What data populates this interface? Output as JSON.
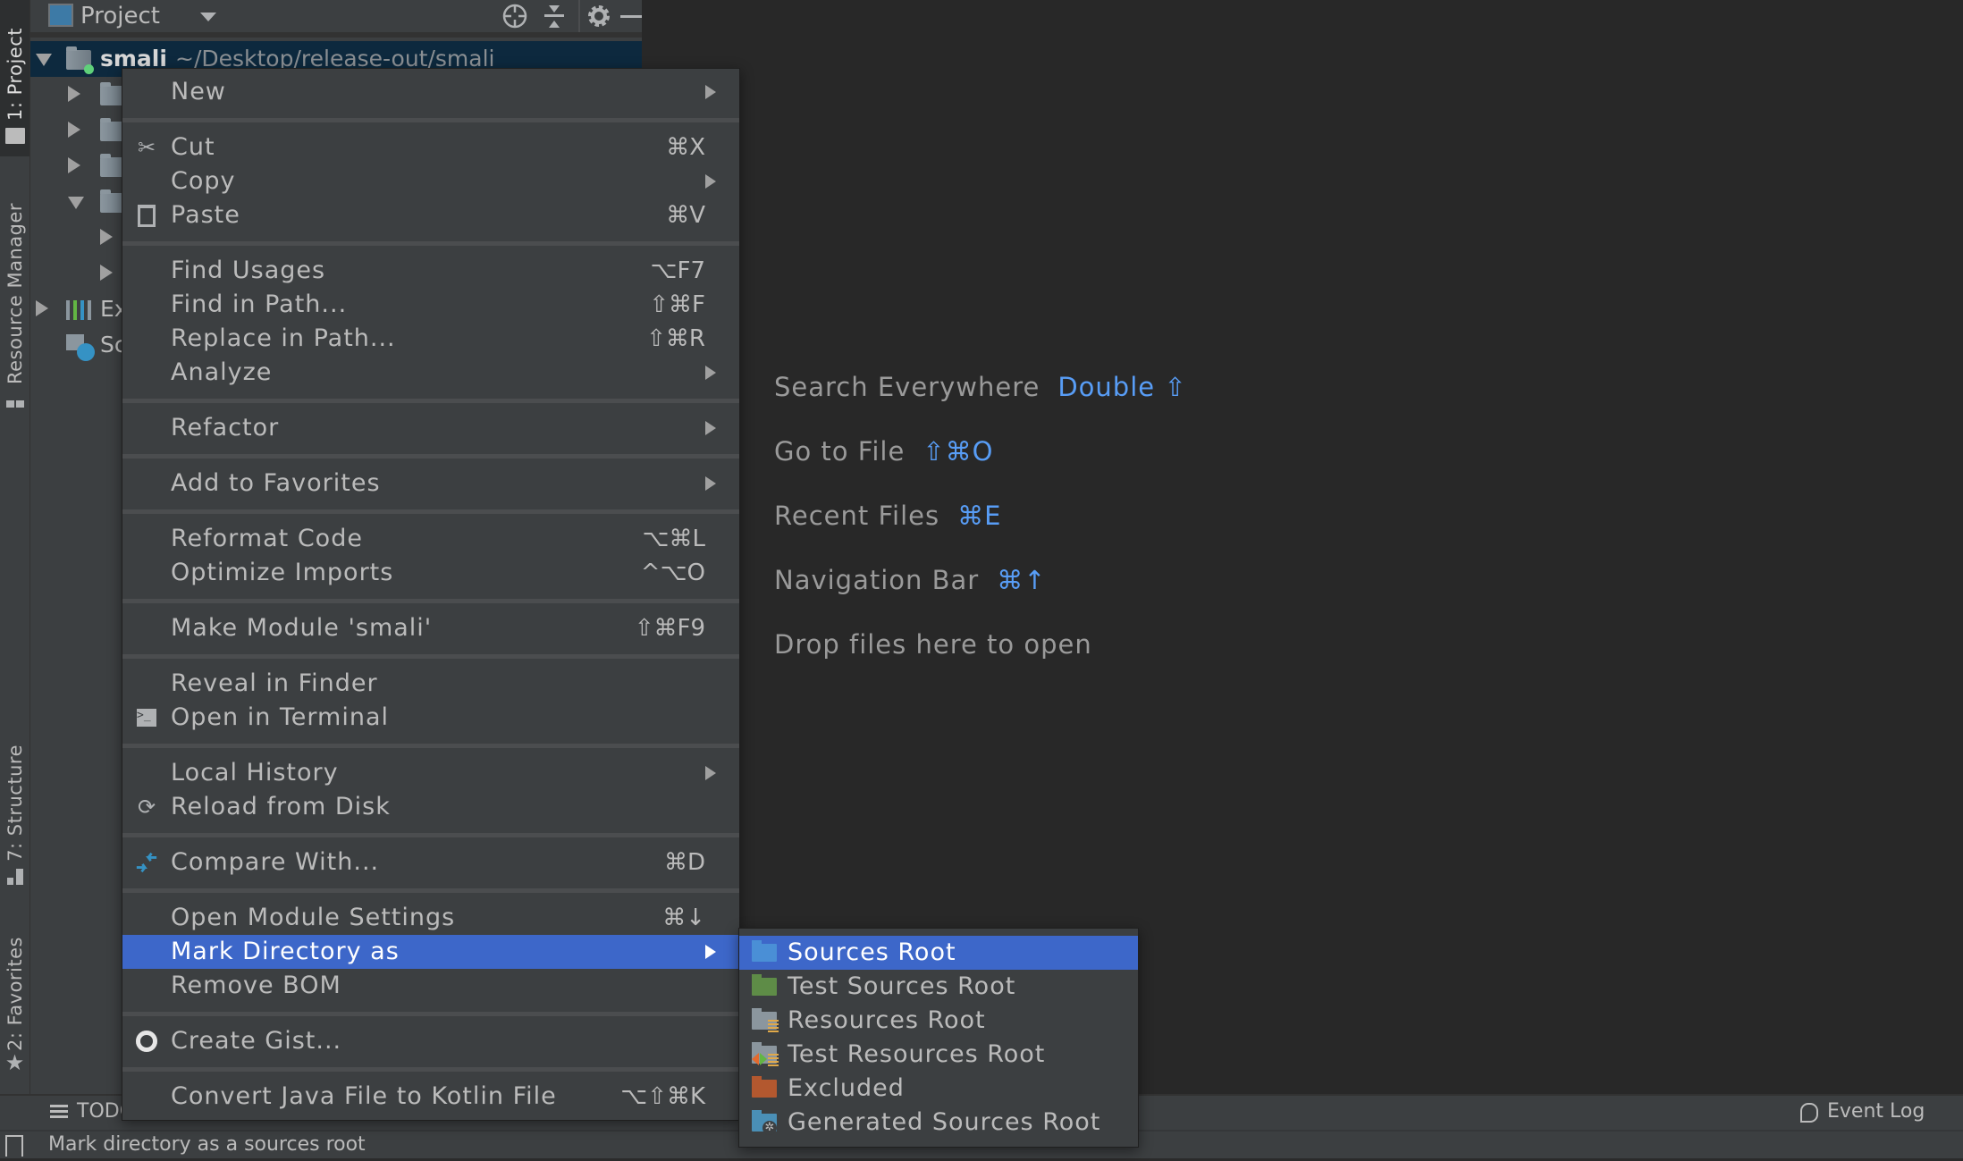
{
  "left_stripe": {
    "tabs": [
      {
        "label": "1: Project",
        "active": true
      },
      {
        "label": "Resource Manager",
        "active": false
      },
      {
        "label": "7: Structure",
        "active": false
      },
      {
        "label": "2: Favorites",
        "active": false
      }
    ]
  },
  "project_panel": {
    "title": "Project",
    "tree": [
      {
        "name": "smali",
        "path": "~/Desktop/release-out/smali",
        "expanded": true,
        "selected": true
      },
      {
        "name": "",
        "expanded": false
      },
      {
        "name": "",
        "expanded": false
      },
      {
        "name": "",
        "expanded": false
      },
      {
        "name": "",
        "expanded": true
      },
      {
        "name": "",
        "expanded": false
      },
      {
        "name": "",
        "expanded": false
      },
      {
        "name": "Ex",
        "expanded": false
      },
      {
        "name": "Sc",
        "expanded": false
      }
    ]
  },
  "editor_hints": [
    {
      "label": "Search Everywhere",
      "shortcut": "Double ⇧"
    },
    {
      "label": "Go to File",
      "shortcut": "⇧⌘O"
    },
    {
      "label": "Recent Files",
      "shortcut": "⌘E"
    },
    {
      "label": "Navigation Bar",
      "shortcut": "⌘↑"
    },
    {
      "label": "Drop files here to open",
      "shortcut": ""
    }
  ],
  "context_menu": {
    "items": [
      {
        "label": "New",
        "shortcut": "",
        "submenu": true,
        "icon": ""
      },
      {
        "label": "Cut",
        "shortcut": "⌘X",
        "submenu": false,
        "icon": "scissors-icon"
      },
      {
        "label": "Copy",
        "shortcut": "",
        "submenu": true,
        "icon": ""
      },
      {
        "label": "Paste",
        "shortcut": "⌘V",
        "submenu": false,
        "icon": "clipboard-icon"
      },
      {
        "label": "Find Usages",
        "shortcut": "⌥F7",
        "submenu": false,
        "icon": ""
      },
      {
        "label": "Find in Path...",
        "shortcut": "⇧⌘F",
        "submenu": false,
        "icon": ""
      },
      {
        "label": "Replace in Path...",
        "shortcut": "⇧⌘R",
        "submenu": false,
        "icon": ""
      },
      {
        "label": "Analyze",
        "shortcut": "",
        "submenu": true,
        "icon": ""
      },
      {
        "label": "Refactor",
        "shortcut": "",
        "submenu": true,
        "icon": ""
      },
      {
        "label": "Add to Favorites",
        "shortcut": "",
        "submenu": true,
        "icon": ""
      },
      {
        "label": "Reformat Code",
        "shortcut": "⌥⌘L",
        "submenu": false,
        "icon": ""
      },
      {
        "label": "Optimize Imports",
        "shortcut": "^⌥O",
        "submenu": false,
        "icon": ""
      },
      {
        "label": "Make Module 'smali'",
        "shortcut": "⇧⌘F9",
        "submenu": false,
        "icon": ""
      },
      {
        "label": "Reveal in Finder",
        "shortcut": "",
        "submenu": false,
        "icon": ""
      },
      {
        "label": "Open in Terminal",
        "shortcut": "",
        "submenu": false,
        "icon": "terminal-icon"
      },
      {
        "label": "Local History",
        "shortcut": "",
        "submenu": true,
        "icon": ""
      },
      {
        "label": "Reload from Disk",
        "shortcut": "",
        "submenu": false,
        "icon": "reload-icon"
      },
      {
        "label": "Compare With...",
        "shortcut": "⌘D",
        "submenu": false,
        "icon": "compare-icon"
      },
      {
        "label": "Open Module Settings",
        "shortcut": "⌘↓",
        "submenu": false,
        "icon": ""
      },
      {
        "label": "Mark Directory as",
        "shortcut": "",
        "submenu": true,
        "icon": "",
        "highlighted": true
      },
      {
        "label": "Remove BOM",
        "shortcut": "",
        "submenu": false,
        "icon": ""
      },
      {
        "label": "Create Gist...",
        "shortcut": "",
        "submenu": false,
        "icon": "github-icon"
      },
      {
        "label": "Convert Java File to Kotlin File",
        "shortcut": "⌥⇧⌘K",
        "submenu": false,
        "icon": ""
      }
    ]
  },
  "mark_directory_submenu": {
    "items": [
      {
        "label": "Sources Root",
        "color": "#4a8fd6",
        "highlighted": true
      },
      {
        "label": "Test Sources Root",
        "color": "#5e8c47"
      },
      {
        "label": "Resources Root",
        "color": "#8b969e"
      },
      {
        "label": "Test Resources Root",
        "color": "#8b969e"
      },
      {
        "label": "Excluded",
        "color": "#b3582f"
      },
      {
        "label": "Generated Sources Root",
        "color": "#4a8fb6"
      }
    ]
  },
  "bottom_bar": {
    "todo_label": "TODO",
    "event_log_label": "Event Log"
  },
  "status_bar": {
    "message": "Mark directory as a sources root"
  },
  "colors": {
    "highlight": "#3d67c9",
    "hint_shortcut": "#589df6",
    "selection_row": "#0d293e"
  }
}
